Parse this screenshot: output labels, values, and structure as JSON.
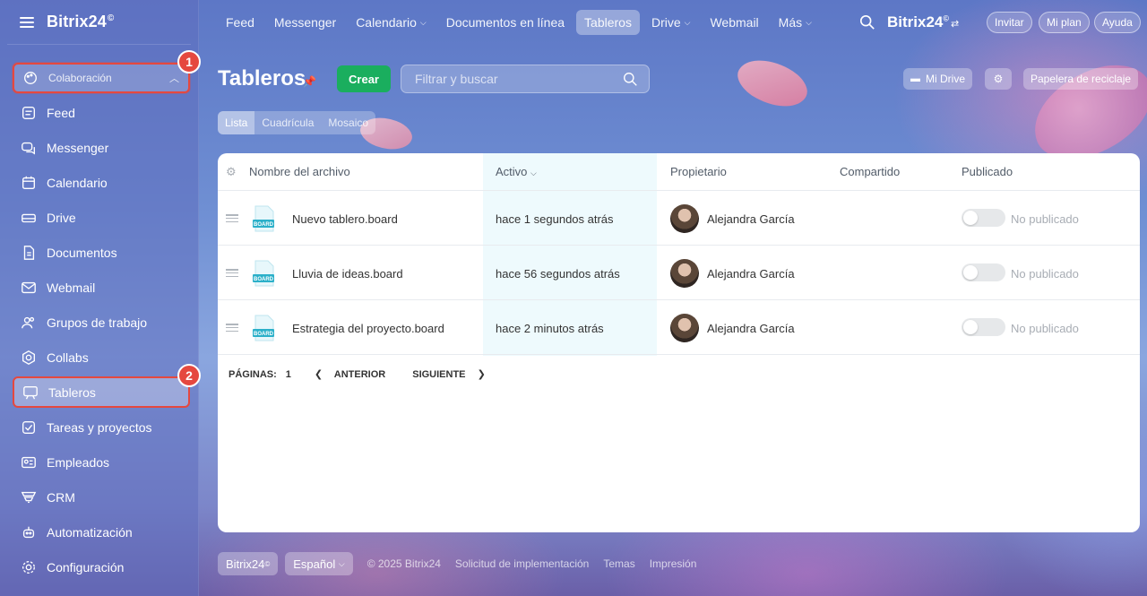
{
  "app": {
    "logo": "Bitrix24",
    "logo_mark": "©"
  },
  "topnav": {
    "items": [
      {
        "label": "Feed"
      },
      {
        "label": "Messenger"
      },
      {
        "label": "Calendario",
        "dropdown": true
      },
      {
        "label": "Documentos en línea"
      },
      {
        "label": "Tableros",
        "active": true
      },
      {
        "label": "Drive",
        "dropdown": true
      },
      {
        "label": "Webmail"
      },
      {
        "label": "Más",
        "dropdown": true
      }
    ],
    "logo": "Bitrix24",
    "invite": "Invitar",
    "plan": "Mi plan",
    "help": "Ayuda"
  },
  "sidebar": {
    "group_label": "Colaboración",
    "items": [
      {
        "label": "Feed",
        "icon": "feed-icon"
      },
      {
        "label": "Messenger",
        "icon": "messenger-icon"
      },
      {
        "label": "Calendario",
        "icon": "calendar-icon"
      },
      {
        "label": "Drive",
        "icon": "drive-icon"
      },
      {
        "label": "Documentos",
        "icon": "document-icon"
      },
      {
        "label": "Webmail",
        "icon": "mail-icon"
      },
      {
        "label": "Grupos de trabajo",
        "icon": "workgroups-icon"
      },
      {
        "label": "Collabs",
        "icon": "collabs-icon"
      },
      {
        "label": "Tableros",
        "icon": "boards-icon",
        "active": true
      },
      {
        "label": "Tareas y proyectos",
        "icon": "tasks-icon"
      },
      {
        "label": "Empleados",
        "icon": "employees-icon"
      },
      {
        "label": "CRM",
        "icon": "crm-icon"
      },
      {
        "label": "Automatización",
        "icon": "automation-icon"
      },
      {
        "label": "Configuración",
        "icon": "settings-icon"
      }
    ]
  },
  "annotations": {
    "badge_1": "1",
    "badge_2": "2"
  },
  "page": {
    "title": "Tableros",
    "create_label": "Crear",
    "search_placeholder": "Filtrar y buscar",
    "my_drive": "Mi Drive",
    "recycle_bin": "Papelera de reciclaje",
    "view_tabs": [
      "Lista",
      "Cuadrícula",
      "Mosaico"
    ]
  },
  "table": {
    "columns": [
      "Nombre del archivo",
      "Activo",
      "Propietario",
      "Compartido",
      "Publicado"
    ],
    "file_icon_label": "BOARD",
    "rows": [
      {
        "name": "Nuevo tablero.board",
        "active": "hace 1 segundos atrás",
        "owner": "Alejandra García",
        "shared": "",
        "published": "No publicado"
      },
      {
        "name": "Lluvia de ideas.board",
        "active": "hace 56 segundos atrás",
        "owner": "Alejandra García",
        "shared": "",
        "published": "No publicado"
      },
      {
        "name": "Estrategia del proyecto.board",
        "active": "hace 2 minutos atrás",
        "owner": "Alejandra García",
        "shared": "",
        "published": "No publicado"
      }
    ],
    "pager": {
      "pages_label": "PÁGINAS:",
      "current": "1",
      "prev": "ANTERIOR",
      "next": "SIGUIENTE"
    }
  },
  "footer": {
    "logo": "Bitrix24",
    "language": "Español",
    "copyright": "© 2025 Bitrix24",
    "links": [
      "Solicitud de implementación",
      "Temas",
      "Impresión"
    ]
  },
  "colors": {
    "accent_green": "#1aae5e",
    "annotation_red": "#e5483f"
  }
}
